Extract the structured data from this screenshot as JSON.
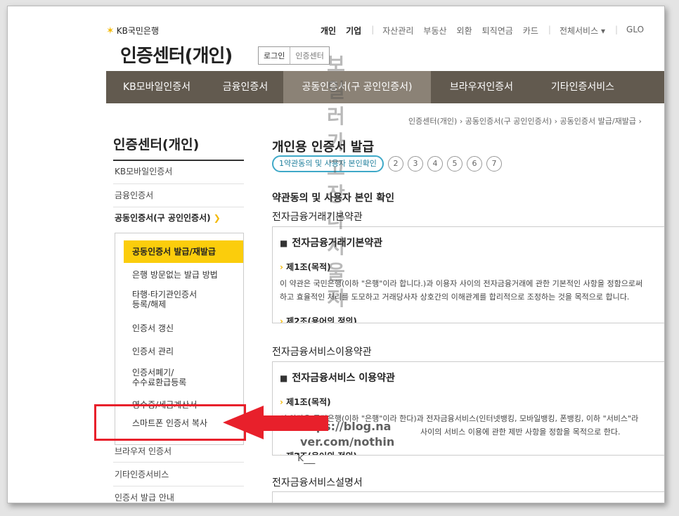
{
  "header": {
    "logo_text": "KB국민은행",
    "site_title": "인증센터(개인)",
    "login_btn": "로그인",
    "cert_center_btn": "인증센터",
    "gnb": [
      "개인",
      "기업",
      "자산관리",
      "부동산",
      "외환",
      "퇴직연금",
      "카드",
      "전체서비스 ▾",
      "GLO"
    ]
  },
  "nav": {
    "items": [
      "KB모바일인증서",
      "금융인증서",
      "공동인증서(구 공인인증서)",
      "브라우저인증서",
      "기타인증서비스"
    ],
    "active_index": 2
  },
  "breadcrumb": [
    "인증센터(개인)",
    "공동인증서(구 공인인증서)",
    "공동인증서 발급/재발급"
  ],
  "sidebar": {
    "title": "인증센터(개인)",
    "items_top": [
      "KB모바일인증서",
      "금융인증서",
      "공동인증서(구 공인인증서)"
    ],
    "submenu": [
      "공동인증서 발급/재발급",
      "은행 방문없는 발급 방법",
      "타행·타기관인증서\n등록/해제",
      "인증서 갱신",
      "인증서 관리",
      "인증서폐기/\n수수료환급등록",
      "영수증/세금계산서",
      "스마트폰 인증서 복사"
    ],
    "items_bottom": [
      "브라우저 인증서",
      "기타인증서비스",
      "인증서 발급 안내"
    ]
  },
  "main": {
    "page_title": "개인용 인증서 발급",
    "step_current": "1약관동의 및 사용자 본인확인",
    "steps": [
      "2",
      "3",
      "4",
      "5",
      "6",
      "7"
    ],
    "section_title": "약관동의 및 사용자 본인 확인",
    "terms1": {
      "heading": "전자금융거래기본약관",
      "box_title": "전자금융거래기본약관",
      "art1_title": "제1조(목적)",
      "art1_text1": "이 약관은 국민은행(이하 \"은행\"이라 합니다.)과 이용자 사이의 전자금융거래에 관한 기본적인 사항을 정함으로써",
      "art1_text2": "하고 효율적인 처리를 도모하고 거래당사자 상호간의 이해관계를 합리적으로 조정하는 것을 목적으로 합니다.",
      "art2_title": "제2조(용어의 정의)"
    },
    "terms2": {
      "heading": "전자금융서비스이용약관",
      "box_title": "전자금융서비스 이용약관",
      "art1_title": "제1조(목적)",
      "art1_text1": "이 약관은 국민은행(이하 \"은행\"이라 한다)과 전자금융서비스(인터넷뱅킹, 모바일뱅킹, 폰뱅킹, 이하 \"서비스\"라",
      "art1_text2": "사이의 서비스 이용에 관한 제반 사항을 정함을 목적으로 한다.",
      "art2_title": "제2조(용어의 정의)"
    },
    "terms3_heading": "전자금융서비스설명서"
  },
  "overlay": {
    "watermark_chars": [
      "보",
      "일",
      "러",
      "가",
      "고",
      "장",
      "나",
      "서",
      "울",
      "지"
    ],
    "url_lines": [
      "https://blog.na",
      "ver.com/nothin",
      "k__"
    ]
  },
  "colors": {
    "nav_bg": "#625a4f",
    "nav_active": "#8b8276",
    "highlight": "#fbcd0c",
    "accent_yellow": "#f3b800",
    "callout_red": "#e8202b"
  }
}
